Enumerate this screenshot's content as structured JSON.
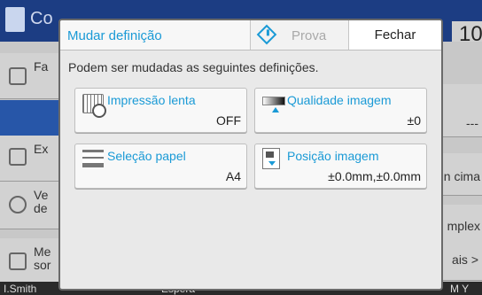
{
  "background": {
    "title_fragment": "Co",
    "count_fragment": "10",
    "left_rows": [
      "Fa",
      "Ex",
      "Ve de",
      "Me sor"
    ],
    "right_rows": [
      "---",
      "n cima",
      "mplex",
      "ais >"
    ],
    "status": {
      "user": "I.Smith",
      "queue": "Espera",
      "toner": "M  Y"
    }
  },
  "dialog": {
    "title": "Mudar definição",
    "proof_label": "Prova",
    "close_label": "Fechar",
    "message": "Podem ser mudadas as seguintes definições.",
    "settings": [
      {
        "name": "Impressão lenta",
        "value": "OFF",
        "icon": "slow-print-icon"
      },
      {
        "name": "Qualidade imagem",
        "value": "±0",
        "icon": "image-quality-icon"
      },
      {
        "name": "Seleção papel",
        "value": "A4",
        "icon": "paper-tray-icon"
      },
      {
        "name": "Posição imagem",
        "value": "±0.0mm,±0.0mm",
        "icon": "image-position-icon"
      }
    ]
  },
  "colors": {
    "accent": "#1a9ad6",
    "topbar": "#1c3d83"
  }
}
